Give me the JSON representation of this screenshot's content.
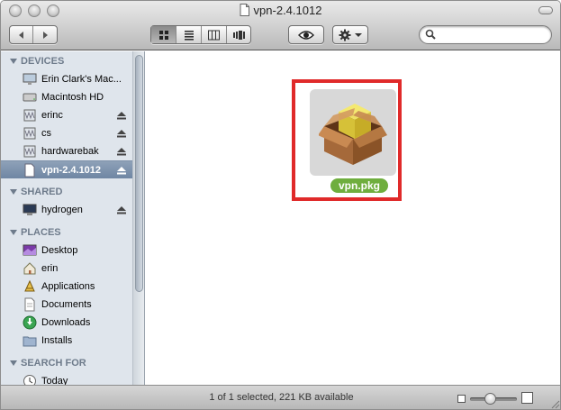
{
  "window": {
    "title": "vpn-2.4.1012"
  },
  "toolbar": {
    "back_label": "Back",
    "forward_label": "Forward",
    "views": [
      "icon-view",
      "list-view",
      "column-view",
      "cover-flow-view"
    ],
    "active_view": "icon-view",
    "search": {
      "value": "",
      "placeholder": ""
    }
  },
  "sidebar": {
    "sections": [
      {
        "title": "DEVICES",
        "items": [
          {
            "label": "Erin Clark's Mac...",
            "icon": "imac-icon",
            "eject": false,
            "selected": false
          },
          {
            "label": "Macintosh HD",
            "icon": "hard-drive-icon",
            "eject": false,
            "selected": false
          },
          {
            "label": "erinc",
            "icon": "network-disk-icon",
            "eject": true,
            "selected": false
          },
          {
            "label": "cs",
            "icon": "network-disk-icon",
            "eject": true,
            "selected": false
          },
          {
            "label": "hardwarebak",
            "icon": "network-disk-icon",
            "eject": true,
            "selected": false
          },
          {
            "label": "vpn-2.4.1012",
            "icon": "disk-image-icon",
            "eject": true,
            "selected": true
          }
        ]
      },
      {
        "title": "SHARED",
        "items": [
          {
            "label": "hydrogen",
            "icon": "shared-computer-icon",
            "eject": true,
            "selected": false
          }
        ]
      },
      {
        "title": "PLACES",
        "items": [
          {
            "label": "Desktop",
            "icon": "desktop-icon",
            "eject": false,
            "selected": false
          },
          {
            "label": "erin",
            "icon": "home-icon",
            "eject": false,
            "selected": false
          },
          {
            "label": "Applications",
            "icon": "applications-icon",
            "eject": false,
            "selected": false
          },
          {
            "label": "Documents",
            "icon": "documents-icon",
            "eject": false,
            "selected": false
          },
          {
            "label": "Downloads",
            "icon": "downloads-icon",
            "eject": false,
            "selected": false
          },
          {
            "label": "Installs",
            "icon": "folder-icon",
            "eject": false,
            "selected": false
          }
        ]
      },
      {
        "title": "SEARCH FOR",
        "items": [
          {
            "label": "Today",
            "icon": "clock-icon",
            "eject": false,
            "selected": false
          }
        ]
      }
    ]
  },
  "content": {
    "files": [
      {
        "name": "vpn.pkg",
        "icon": "package-icon",
        "selected": true
      }
    ]
  },
  "status": {
    "text": "1 of 1 selected, 221 KB available",
    "icon_size_level": 0.45
  },
  "colors": {
    "highlight_box": "#e02a2a",
    "file_label_bg": "#6fae3e",
    "sidebar_bg": "#dfe5ec",
    "sidebar_selected": "#6f86a3"
  }
}
